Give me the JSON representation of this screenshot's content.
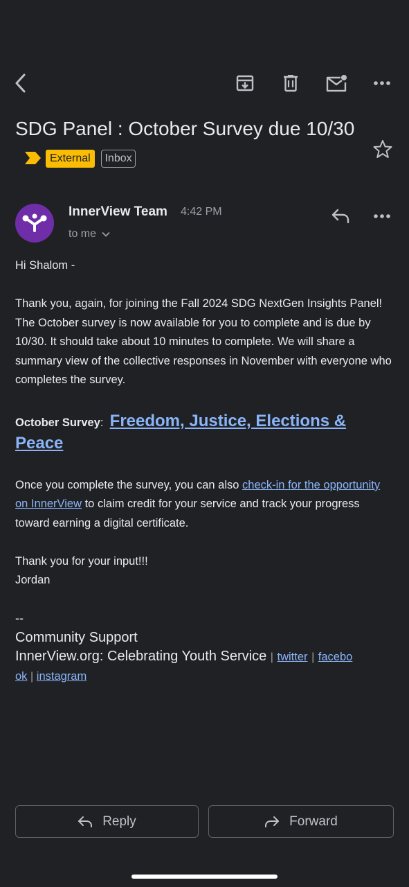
{
  "toolbar": {
    "back_icon": "back-arrow-icon",
    "archive_icon": "archive-icon",
    "delete_icon": "trash-icon",
    "mark_unread_icon": "mail-unread-icon",
    "more_icon": "more-horizontal-icon"
  },
  "email": {
    "subject": "SDG Panel : October Survey due 10/30",
    "label_external": "External",
    "label_inbox": "Inbox",
    "sender_name": "InnerView Team",
    "time": "4:42 PM",
    "recipient": "to me"
  },
  "body": {
    "greeting": "Hi Shalom -",
    "paragraph1": "Thank you, again, for joining the Fall 2024 SDG NextGen Insights Panel! The October survey is now available for you to complete and is due by 10/30. It should take about 10 minutes to complete. We will share a summary view of the collective responses in November with everyone who completes the survey.",
    "survey_label": "October Survey",
    "survey_colon": ":",
    "survey_link": "Freedom, Justice, Elections & Peace",
    "para3_before": "Once you complete the survey, you can also ",
    "para3_link": "check-in for the opportunity on InnerView",
    "para3_after": " to claim credit for your service and track your progress toward earning a digital certificate.",
    "thanks": "Thank you for your input!!!",
    "signoff": "Jordan",
    "sig_dashes": "--",
    "sig_team": "Community Support",
    "sig_org": "InnerView.org: Celebrating Youth Service",
    "link_twitter": "twitter",
    "link_facebook_a": "facebo",
    "link_facebook_b": "ok",
    "link_instagram": "instagram",
    "separator": "|"
  },
  "actions": {
    "reply": "Reply",
    "forward": "Forward"
  },
  "colors": {
    "background": "#202124",
    "link": "#8ab4f8",
    "external_badge": "#fbbc04",
    "avatar": "#6f2da8"
  }
}
